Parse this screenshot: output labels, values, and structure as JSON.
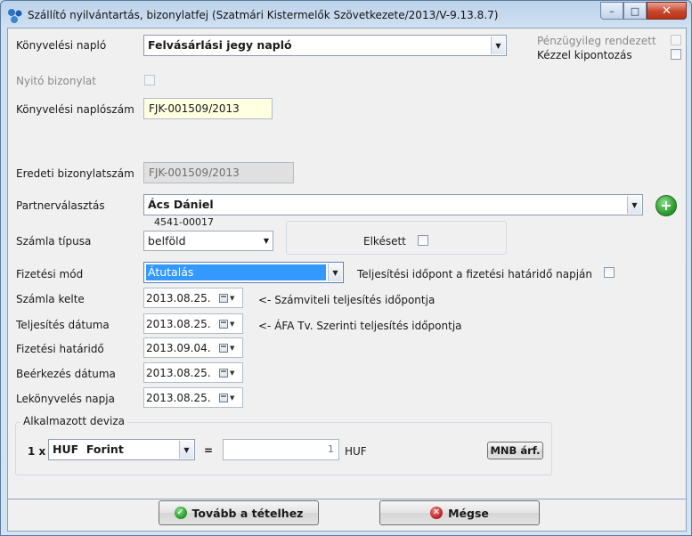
{
  "window": {
    "title": "Szállító nyilvántartás, bizonylatfej (Szatmári Kistermelők Szövetkezete/2013/V-9.13.8.7)",
    "minimize": "–",
    "maximize": "□",
    "close": "✕"
  },
  "form": {
    "konyvelesi_naplo_label": "Könyvelési napló",
    "konyvelesi_naplo_value": "Felvásárlási jegy napló",
    "penzugyileg_label": "Pénzügyileg rendezett",
    "kezzel_label": "Kézzel kipontozás",
    "nyito_label": "Nyitó bizonylat",
    "naploszam_label": "Könyvelési naplószám",
    "naploszam_value": "FJK-001509/2013",
    "eredeti_label": "Eredeti bizonylatszám",
    "eredeti_value": "FJK-001509/2013",
    "partner_label": "Partnerválasztás",
    "partner_value": "Ács Dániel",
    "partner_code": "4541-00017",
    "szamla_tipusa_label": "Számla típusa",
    "szamla_tipusa_value": "belföld",
    "elkesett_label": "Elkésett",
    "fizetesi_mod_label": "Fizetési mód",
    "fizetesi_mod_value": "Átutalás",
    "teljesitesi_hatarido_label": "Teljesítési időpont a fizetési határidő napján",
    "szamla_kelte_label": "Számla kelte",
    "szamla_kelte_value": "2013.08.25.",
    "szamla_kelte_note": "<- Számviteli teljesítés időpontja",
    "teljesites_label": "Teljesítés dátuma",
    "teljesites_value": "2013.08.25.",
    "teljesites_note": "<- ÁFA Tv. Szerinti teljesítés időpontja",
    "fizetesi_hatarido_label": "Fizetési határidő",
    "fizetesi_hatarido_value": "2013.09.04.",
    "beerkezes_label": "Beérkezés dátuma",
    "beerkezes_value": "2013.08.25.",
    "lekonyveles_label": "Lekönyvelés napja",
    "lekonyveles_value": "2013.08.25."
  },
  "deviza": {
    "group_label": "Alkalmazott deviza",
    "multiplier": "1 x",
    "currency_value": "HUF  Forint",
    "equals": "=",
    "rate_value": "1",
    "unit": "HUF",
    "mnb_button": "MNB árf."
  },
  "footer": {
    "next_button": "Tovább a tételhez",
    "cancel_button": "Mégse"
  },
  "colors": {
    "selected_bg": "#3399ff",
    "readonly_yellow": "#ffffe1",
    "disabled_gray": "#e0e0e0",
    "add_green": "#2e9e2e",
    "cancel_red": "#c0282a"
  }
}
